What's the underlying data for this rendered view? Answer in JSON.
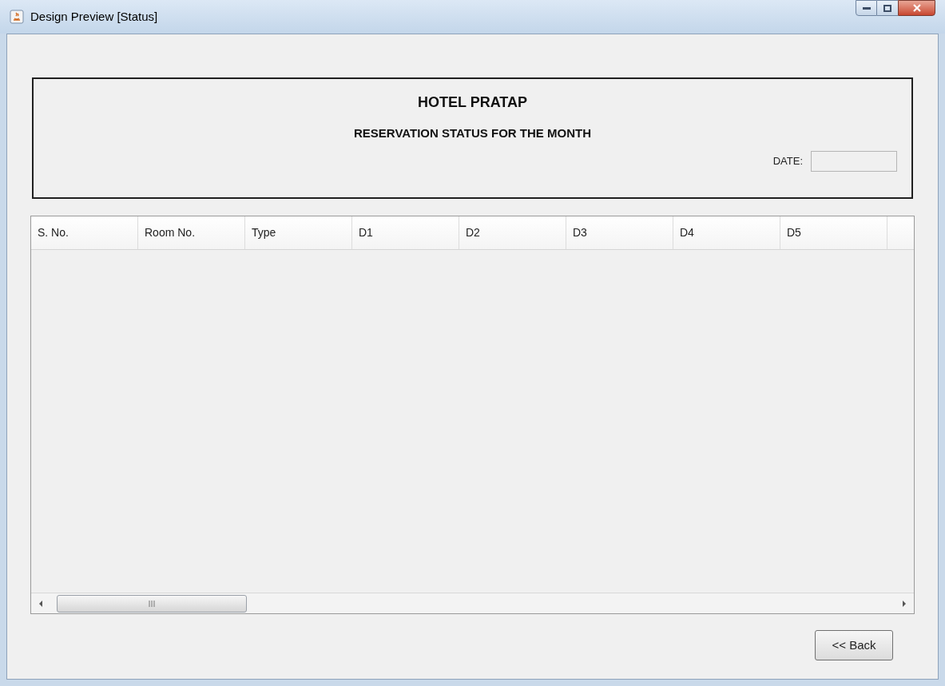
{
  "window": {
    "title": "Design Preview [Status]"
  },
  "header": {
    "title": "HOTEL PRATAP",
    "subtitle": "RESERVATION STATUS FOR THE MONTH",
    "date_label": "DATE:"
  },
  "table": {
    "columns": [
      "S. No.",
      "Room No.",
      "Type",
      "D1",
      "D2",
      "D3",
      "D4",
      "D5"
    ]
  },
  "buttons": [
    "<< Back"
  ]
}
